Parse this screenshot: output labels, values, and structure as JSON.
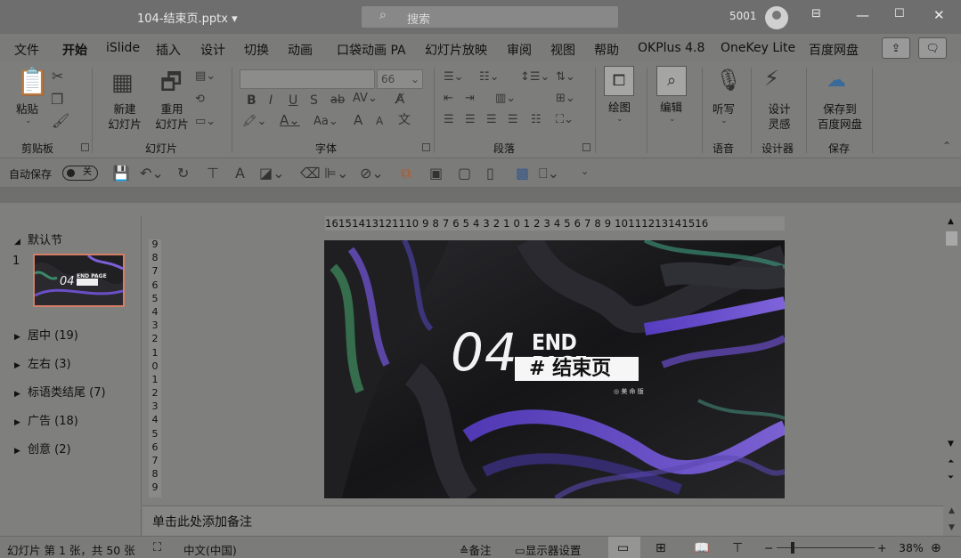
{
  "titlebar": {
    "doc_name": "104-结束页.pptx",
    "search_placeholder": "搜索",
    "user": "5001",
    "buttons": [
      "ribbon-display-icon",
      "minimize-icon",
      "maximize-icon",
      "close-icon"
    ]
  },
  "menu": {
    "tabs": [
      "文件",
      "开始",
      "iSlide",
      "插入",
      "设计",
      "切换",
      "动画",
      "口袋动画 PA",
      "幻灯片放映",
      "审阅",
      "视图",
      "帮助",
      "OKPlus 4.8",
      "OneKey Lite",
      "百度网盘"
    ],
    "active": "开始"
  },
  "ribbon": {
    "clipboard": {
      "paste": "粘贴",
      "label": "剪贴板"
    },
    "slides": {
      "new_line1": "新建",
      "new_line2": "幻灯片",
      "reuse_line1": "重用",
      "reuse_line2": "幻灯片",
      "label": "幻灯片"
    },
    "font": {
      "font_name": "",
      "font_size": "66",
      "label": "字体"
    },
    "paragraph": {
      "label": "段落"
    },
    "drawing": {
      "draw": "绘图"
    },
    "editing": {
      "edit": "编辑"
    },
    "voice": {
      "dictate": "听写",
      "label": "语音"
    },
    "designer": {
      "line1": "设计",
      "line2": "灵感",
      "label": "设计器"
    },
    "save": {
      "line1": "保存到",
      "line2": "百度网盘",
      "label": "保存"
    }
  },
  "qat": {
    "autosave": "自动保存",
    "toggle": "关"
  },
  "thumbs": {
    "default_section": "默认节",
    "slide_number": "1",
    "sections": [
      {
        "label": "居中 (19)"
      },
      {
        "label": "左右 (3)"
      },
      {
        "label": "标语类结尾 (7)"
      },
      {
        "label": "广告 (18)"
      },
      {
        "label": "创意 (2)"
      }
    ]
  },
  "ruler": {
    "horizontal": "16151413121110 9 8 7 6 5 4 3 2 1 0 1 2 3 4 5 6 7 8 9 10111213141516",
    "vertical": [
      "9",
      "8",
      "7",
      "6",
      "5",
      "4",
      "3",
      "2",
      "1",
      "0",
      "1",
      "2",
      "3",
      "4",
      "5",
      "6",
      "7",
      "8",
      "9"
    ]
  },
  "slide": {
    "number_text": "04",
    "title_en": "END PAGE",
    "title_zh": "# 结束页",
    "brand": "◎ 美 命 版"
  },
  "notes_placeholder": "单击此处添加备注",
  "status": {
    "slide_info": "幻灯片 第 1 张，共 50 张",
    "language": "中文(中国)",
    "notes": "备注",
    "display_settings": "显示器设置",
    "zoom": "38%"
  }
}
